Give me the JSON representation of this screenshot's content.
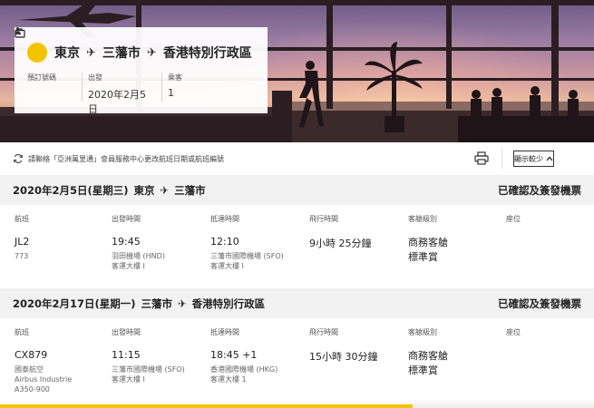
{
  "trip": {
    "origin": "東京",
    "via": "三藩市",
    "destination": "香港特別行政區",
    "booking_ref_label": "預訂號碼",
    "booking_ref_value": "",
    "departure_label": "出發",
    "departure_value": "2020年2月5日",
    "passengers_label": "乘客",
    "passengers_value": "1"
  },
  "notice": {
    "text": "請聯絡「亞洲萬里通」會員服務中心更改航班日期或航班編號",
    "show_less_label": "顯示較少"
  },
  "column_labels": {
    "flight": "航班",
    "departure_time": "出發時間",
    "arrival_time": "抵達時間",
    "flight_time": "飛行時間",
    "cabin_class": "客艙級別",
    "seat": "座位"
  },
  "segments": [
    {
      "date": "2020年2月5日(星期三)",
      "from": "東京",
      "to": "三藩市",
      "status": "已確認及簽發機票",
      "flight_no": "JL2",
      "flight_sub": [
        "773"
      ],
      "dep_time": "19:45",
      "dep_airport": "羽田機場 (HND)",
      "dep_terminal": "客運大樓 I",
      "arr_time": "12:10",
      "arr_airport": "三藩市國際機場 (SFO)",
      "arr_terminal": "客運大樓 I",
      "duration": "9小時 25分鐘",
      "cabin": "商務客艙",
      "fare": "標準賞",
      "seat": ""
    },
    {
      "date": "2020年2月17日(星期一)",
      "from": "三藩市",
      "to": "香港特別行政區",
      "status": "已確認及簽發機票",
      "flight_no": "CX879",
      "flight_sub": [
        "國泰航空",
        "Airbus Industrie",
        "A350-900"
      ],
      "dep_time": "11:15",
      "dep_airport": "三藩市國際機場 (SFO)",
      "dep_terminal": "客運大樓 I",
      "arr_time": "18:45 +1",
      "arr_airport": "香港國際機場 (HKG)",
      "arr_terminal": "客運大樓 1",
      "duration": "15小時 30分鐘",
      "cabin": "商務客艙",
      "fare": "標準賞",
      "seat": ""
    }
  ],
  "colors": {
    "accent_yellow": "#f3c300",
    "header_gray": "#f2f2f2"
  },
  "icons": {
    "trip": "suitcase-icon",
    "plane": "plane-icon",
    "person": "person-icon",
    "refresh": "refresh-icon",
    "print": "printer-icon",
    "chevron": "chevron-up-icon"
  }
}
